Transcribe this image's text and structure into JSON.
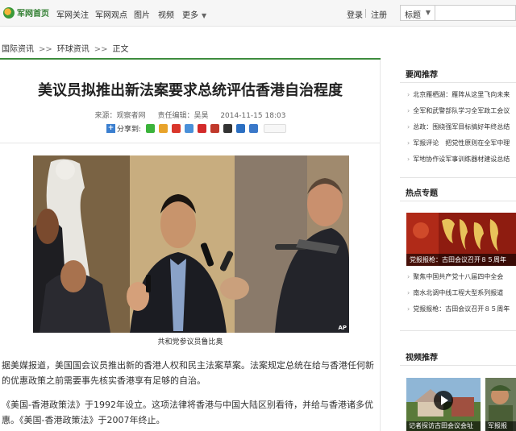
{
  "topnav": {
    "logo_text": "军网首页",
    "links": [
      "军网关注",
      "军网观点",
      "图片",
      "视频",
      "更多"
    ],
    "login": "登录",
    "register": "注册",
    "search_scope": "标题",
    "search_placeholder": ""
  },
  "breadcrumb": [
    "国际资讯",
    "环球资讯",
    "正文"
  ],
  "breadcrumb_sep": ">>",
  "article": {
    "headline": "美议员拟推出新法案要求总统评估香港自治程度",
    "source": "来源：观察者网",
    "editor": "责任编辑：吴昊",
    "datetime": "2014-11-15 18:03",
    "share_label": "分享到:",
    "photo_credit": "AP",
    "caption": "共和党参议员鲁比奥",
    "paragraphs": [
      "据美媒报道，美国国会议员推出新的香港人权和民主法案草案。法案规定总统在给与香港任何新的优惠政策之前需要事先核实香港享有足够的自治。",
      "《美国-香港政策法》于1992年设立。这项法律将香港与中国大陆区别看待，并给与香港诸多优惠。《美国-香港政策法》于2007年终止。"
    ]
  },
  "sidebar": {
    "news_title": "要闻推荐",
    "news_items": [
      "北京雁栖湖：雁阵从这里飞向未来",
      "全军和武警部队学习全军政工会议",
      "总政：围绕强军目标搞好年终总结",
      "军报评论　把党性原则在全军中理",
      "军地协作设军事训练器材建设总结"
    ],
    "hot_title": "热点专题",
    "hot_overlay": "党报报枪：古田会议召开８５周年",
    "hot_items": [
      "聚焦中国共产党十八届四中全会",
      "南水北调中线工程大型系列报道",
      "党报报枪：古田会议召开８５周年"
    ],
    "video_title": "视频推荐",
    "video_overlay_1": "记者探访古田会议会址",
    "video_overlay_2": "军报报"
  },
  "colors": {
    "accent_green": "#3d8c3d",
    "share_blue": "#3b7fd0"
  }
}
